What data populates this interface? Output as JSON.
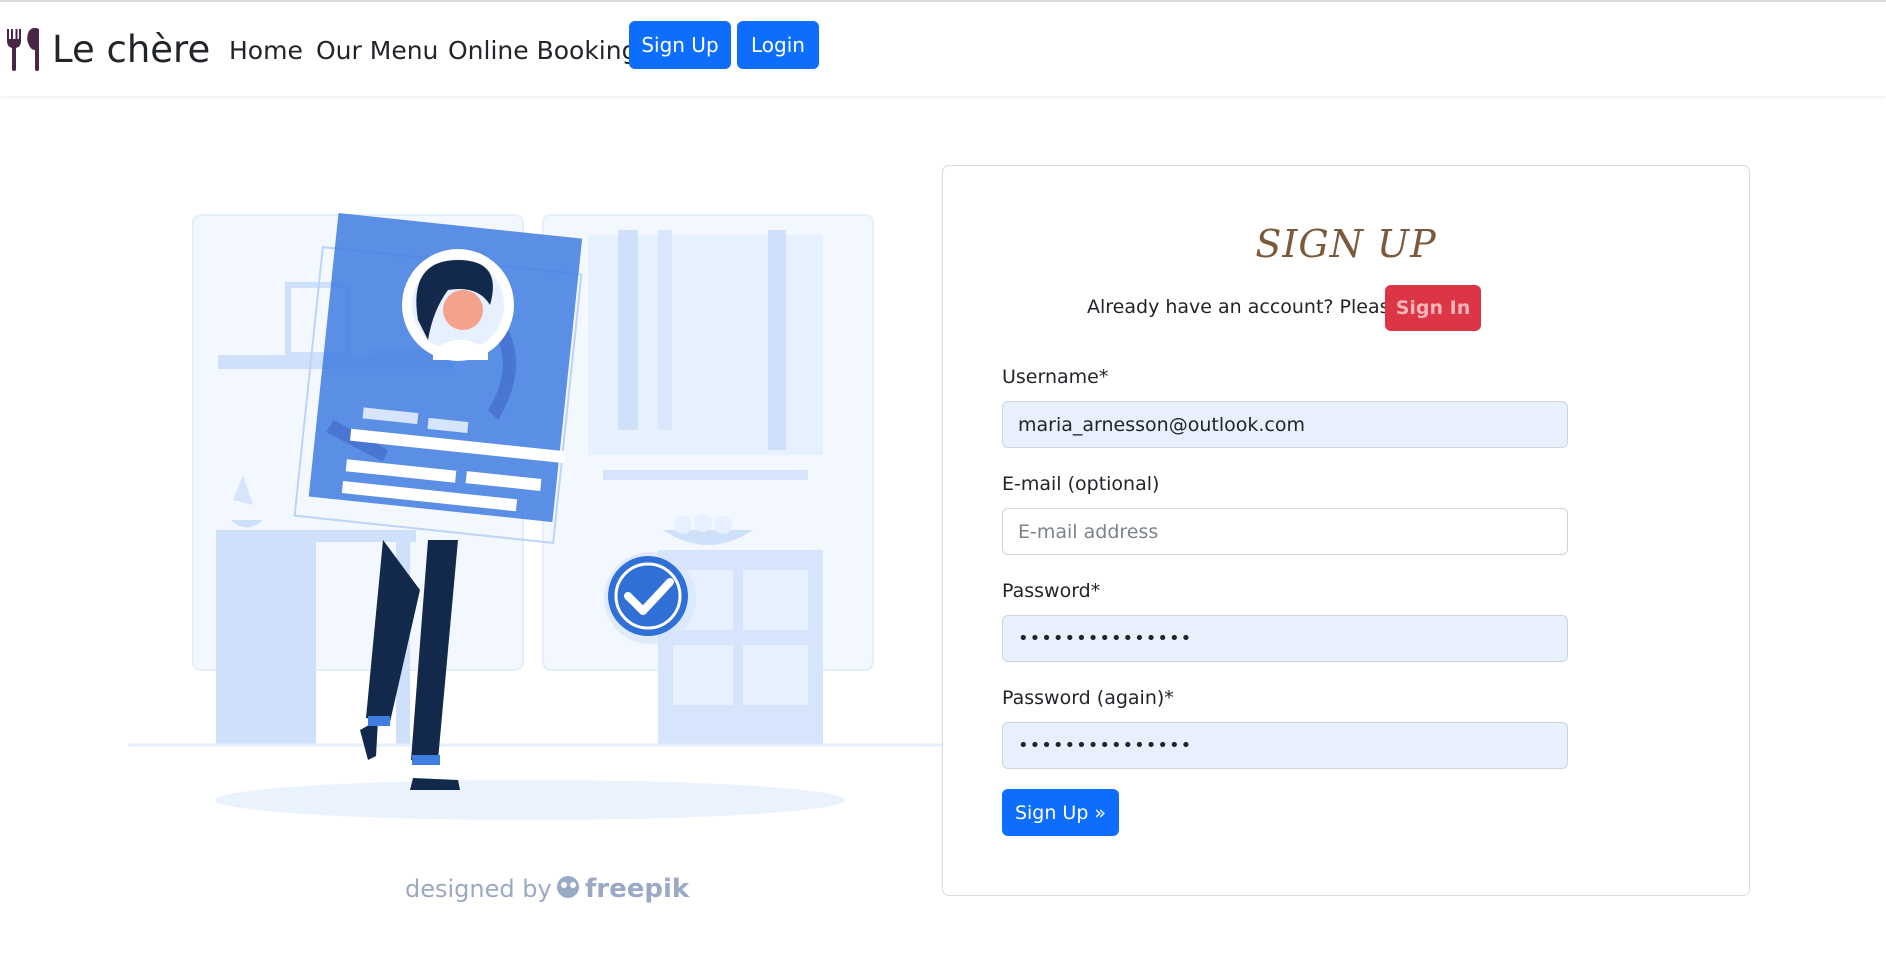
{
  "navbar": {
    "brand": "Le chère",
    "links": [
      "Home",
      "Our Menu",
      "Online Booking"
    ],
    "signup_label": "Sign Up",
    "login_label": "Login"
  },
  "illustration": {
    "credit_prefix": "designed by",
    "credit_brand": "freepik"
  },
  "form": {
    "title": "SIGN UP",
    "already_text": "Already have an account? Please",
    "signin_label": "Sign In",
    "username_label": "Username*",
    "username_value": "maria_arnesson@outlook.com",
    "email_label": "E-mail (optional)",
    "email_placeholder": "E-mail address",
    "password_label": "Password*",
    "password_value": "•••••••••••••••",
    "password2_label": "Password (again)*",
    "password2_value": "•••••••••••••••",
    "submit_label": "Sign Up »"
  },
  "colors": {
    "primary": "#0d6efd",
    "danger": "#dc3545",
    "title": "#7b5a3c",
    "brand_icon": "#4a2545",
    "autofill": "#e8f0fe"
  }
}
